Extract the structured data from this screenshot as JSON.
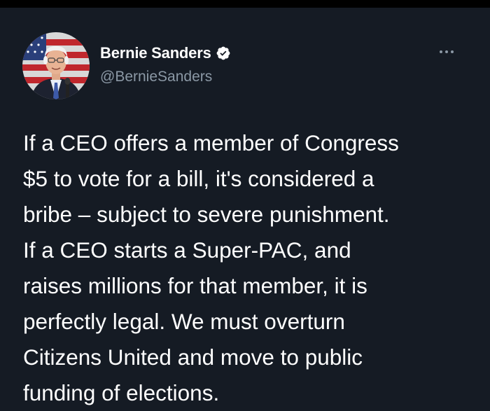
{
  "author": {
    "display_name": "Bernie Sanders",
    "handle": "@BernieSanders",
    "verified": true
  },
  "tweet": {
    "text": "If a CEO offers a member of Congress\n$5 to vote for a bill, it's considered a\nbribe – subject to severe punishment.\nIf a CEO starts a Super-PAC, and\nraises millions for that member, it is\nperfectly legal. We must overturn\nCitizens United and move to public\nfunding of elections."
  },
  "icons": {
    "verified": "verified-badge-icon",
    "more": "more-options-icon"
  },
  "colors": {
    "background": "#151b24",
    "text": "#ffffff",
    "handle": "#8b98a5",
    "verified": "#ffffff"
  }
}
